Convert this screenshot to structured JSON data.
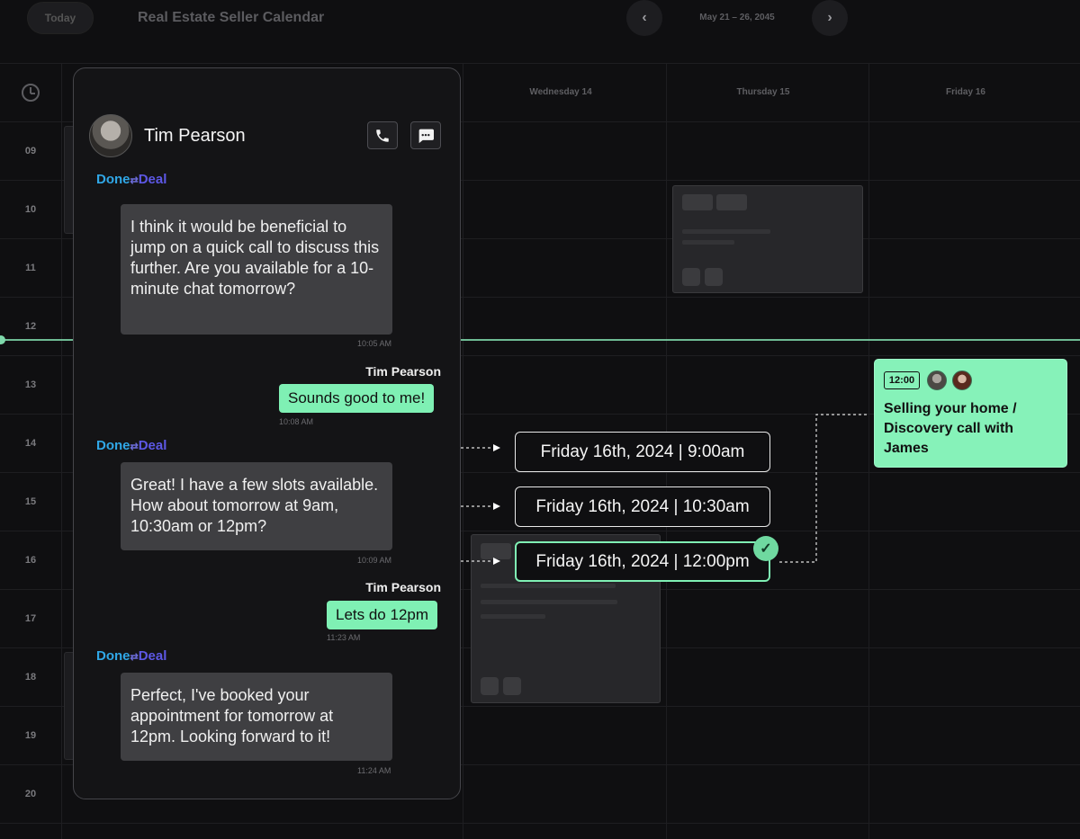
{
  "header": {
    "today_label": "Today",
    "title": "Real Estate Seller Calendar",
    "date_range": "May 21 – 26, 2045",
    "prev_icon": "chevron-left-icon",
    "next_icon": "chevron-right-icon"
  },
  "calendar": {
    "days": [
      "Wednesday 14",
      "Thursday 15",
      "Friday 16"
    ],
    "hours": [
      "09",
      "10",
      "11",
      "12",
      "13",
      "14",
      "15",
      "16",
      "17",
      "18",
      "19",
      "20"
    ],
    "now_line_color": "#7fd9ab"
  },
  "chat": {
    "contact_name": "Tim Pearson",
    "brand": {
      "part1": "Done",
      "separator": "⇄",
      "part2": "Deal"
    },
    "messages": [
      {
        "from": "agent",
        "text": "I think it would be beneficial to jump on a quick call to discuss this further. Are you available for a 10-minute chat tomorrow?",
        "time": "10:05 AM"
      },
      {
        "from": "client",
        "sender": "Tim Pearson",
        "text": "Sounds good to me!",
        "time": "10:08 AM"
      },
      {
        "from": "agent",
        "text": "Great! I have a few slots available. How about tomorrow at 9am, 10:30am or 12pm?",
        "time": "10:09 AM"
      },
      {
        "from": "client",
        "sender": "Tim Pearson",
        "text": "Lets do 12pm",
        "time": "11:23 AM"
      },
      {
        "from": "agent",
        "text": "Perfect, I've booked your appointment for tomorrow at 12pm. Looking forward to it!",
        "time": "11:24 AM"
      }
    ]
  },
  "slots": [
    {
      "label": "Friday 16th, 2024 | 9:00am",
      "selected": false
    },
    {
      "label": "Friday 16th, 2024 | 10:30am",
      "selected": false
    },
    {
      "label": "Friday 16th, 2024 | 12:00pm",
      "selected": true
    }
  ],
  "event": {
    "time": "12:00",
    "title": "Selling your home / Discovery call with James",
    "color": "#86f2b9"
  },
  "colors": {
    "accent": "#7ff0b4",
    "background": "#0f0f11",
    "bubble_agent": "#3f3f42"
  }
}
